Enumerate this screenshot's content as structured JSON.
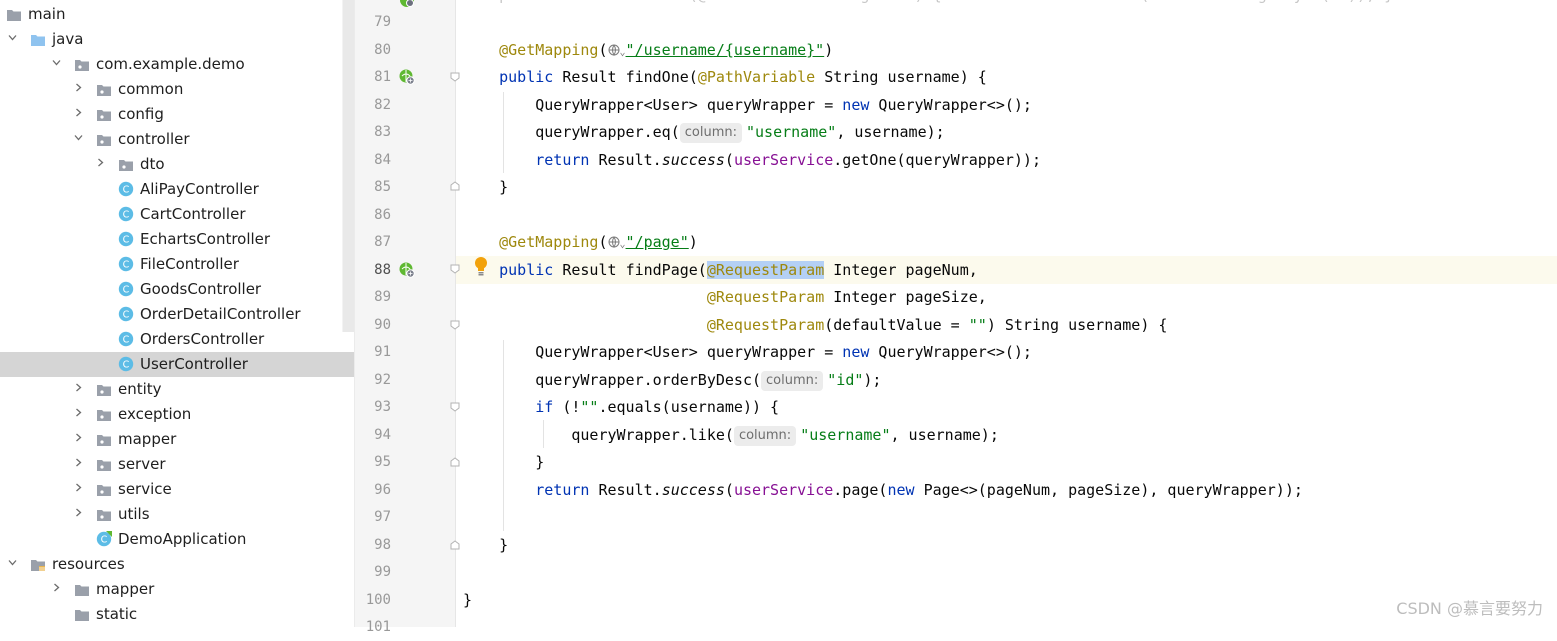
{
  "tree": {
    "items": [
      {
        "label": "main",
        "type": "folder",
        "depth": 0,
        "arrow": "none"
      },
      {
        "label": "java",
        "type": "source-folder",
        "depth": 0,
        "arrow": "down"
      },
      {
        "label": "com.example.demo",
        "type": "package",
        "depth": 1,
        "arrow": "down"
      },
      {
        "label": "common",
        "type": "package",
        "depth": 2,
        "arrow": "right"
      },
      {
        "label": "config",
        "type": "package",
        "depth": 2,
        "arrow": "right"
      },
      {
        "label": "controller",
        "type": "package",
        "depth": 2,
        "arrow": "down"
      },
      {
        "label": "dto",
        "type": "package",
        "depth": 3,
        "arrow": "right"
      },
      {
        "label": "AliPayController",
        "type": "class",
        "depth": 3,
        "arrow": "none"
      },
      {
        "label": "CartController",
        "type": "class",
        "depth": 3,
        "arrow": "none"
      },
      {
        "label": "EchartsController",
        "type": "class",
        "depth": 3,
        "arrow": "none"
      },
      {
        "label": "FileController",
        "type": "class",
        "depth": 3,
        "arrow": "none"
      },
      {
        "label": "GoodsController",
        "type": "class",
        "depth": 3,
        "arrow": "none"
      },
      {
        "label": "OrderDetailController",
        "type": "class",
        "depth": 3,
        "arrow": "none"
      },
      {
        "label": "OrdersController",
        "type": "class",
        "depth": 3,
        "arrow": "none"
      },
      {
        "label": "UserController",
        "type": "class",
        "depth": 3,
        "arrow": "none",
        "selected": true
      },
      {
        "label": "entity",
        "type": "package",
        "depth": 2,
        "arrow": "right"
      },
      {
        "label": "exception",
        "type": "package",
        "depth": 2,
        "arrow": "right"
      },
      {
        "label": "mapper",
        "type": "package",
        "depth": 2,
        "arrow": "right"
      },
      {
        "label": "server",
        "type": "package",
        "depth": 2,
        "arrow": "right"
      },
      {
        "label": "service",
        "type": "package",
        "depth": 2,
        "arrow": "right"
      },
      {
        "label": "utils",
        "type": "package",
        "depth": 2,
        "arrow": "right"
      },
      {
        "label": "DemoApplication",
        "type": "spring-class",
        "depth": 2,
        "arrow": "none"
      },
      {
        "label": "resources",
        "type": "resources-folder",
        "depth": 0,
        "arrow": "down"
      },
      {
        "label": "mapper",
        "type": "folder",
        "depth": 1,
        "arrow": "right"
      },
      {
        "label": "static",
        "type": "folder",
        "depth": 1,
        "arrow": "none"
      }
    ]
  },
  "editor": {
    "current_line": "88",
    "partial_top_code": "    public Result findOne(@PathVariable Integer id) { return Result.success(userService.getById(id)); }",
    "lines": {
      "l79": "79",
      "l80": "80",
      "l81": "81",
      "l82": "82",
      "l83": "83",
      "l84": "84",
      "l85": "85",
      "l86": "86",
      "l87": "87",
      "l88": "88",
      "l89": "89",
      "l90": "90",
      "l91": "91",
      "l92": "92",
      "l93": "93",
      "l94": "94",
      "l95": "95",
      "l96": "96",
      "l97": "97",
      "l98": "98",
      "l99": "99",
      "l100": "100",
      "l101": "101"
    },
    "tok": {
      "getmapping": "@GetMapping",
      "url_username": "\"/username/{username}\"",
      "url_page": "\"/page\"",
      "close_paren": ")",
      "public": "public",
      "result": "Result",
      "findone": "findOne(",
      "pathvariable": "@PathVariable",
      "string_username_brace": "String username) {",
      "qw_decl_a": "QueryWrapper<User> queryWrapper = ",
      "new": "new",
      "qw_decl_b": "QueryWrapper<>();",
      "qw_eq": "queryWrapper.eq(",
      "hint_column": "column:",
      "str_username": "\"username\"",
      "comma_username_end": ", username);",
      "return": "return",
      "result_dot": "Result.",
      "success": "success",
      "userservice": "userService",
      "getone": ".getOne(queryWrapper));",
      "brace_close": "}",
      "findpage": "findPage(",
      "requestparam": "@RequestParam",
      "int_pagenum": "Integer pageNum,",
      "int_pagesize": "Integer pageSize,",
      "default_value_a": "(defaultValue = ",
      "empty_str": "\"\"",
      "default_value_b": ") String username) {",
      "orderbydesc": "queryWrapper.orderByDesc(",
      "str_id": "\"id\"",
      "semi_end": ");",
      "if": "if",
      "if_a": " (!",
      "equals_b": ".equals(username)) {",
      "like": "queryWrapper.like(",
      "page_a": ".page(",
      "page_b": "Page<>(pageNum, pageSize), queryWrapper));"
    }
  },
  "watermark": "CSDN @慕言要努力",
  "colors": {
    "keyword": "#0033b3",
    "annotation": "#9e880d",
    "string": "#067d17",
    "field": "#871094",
    "selection": "#b4d0f5",
    "current_line": "#fcfaed",
    "tree_selection": "#d5d5d5"
  }
}
